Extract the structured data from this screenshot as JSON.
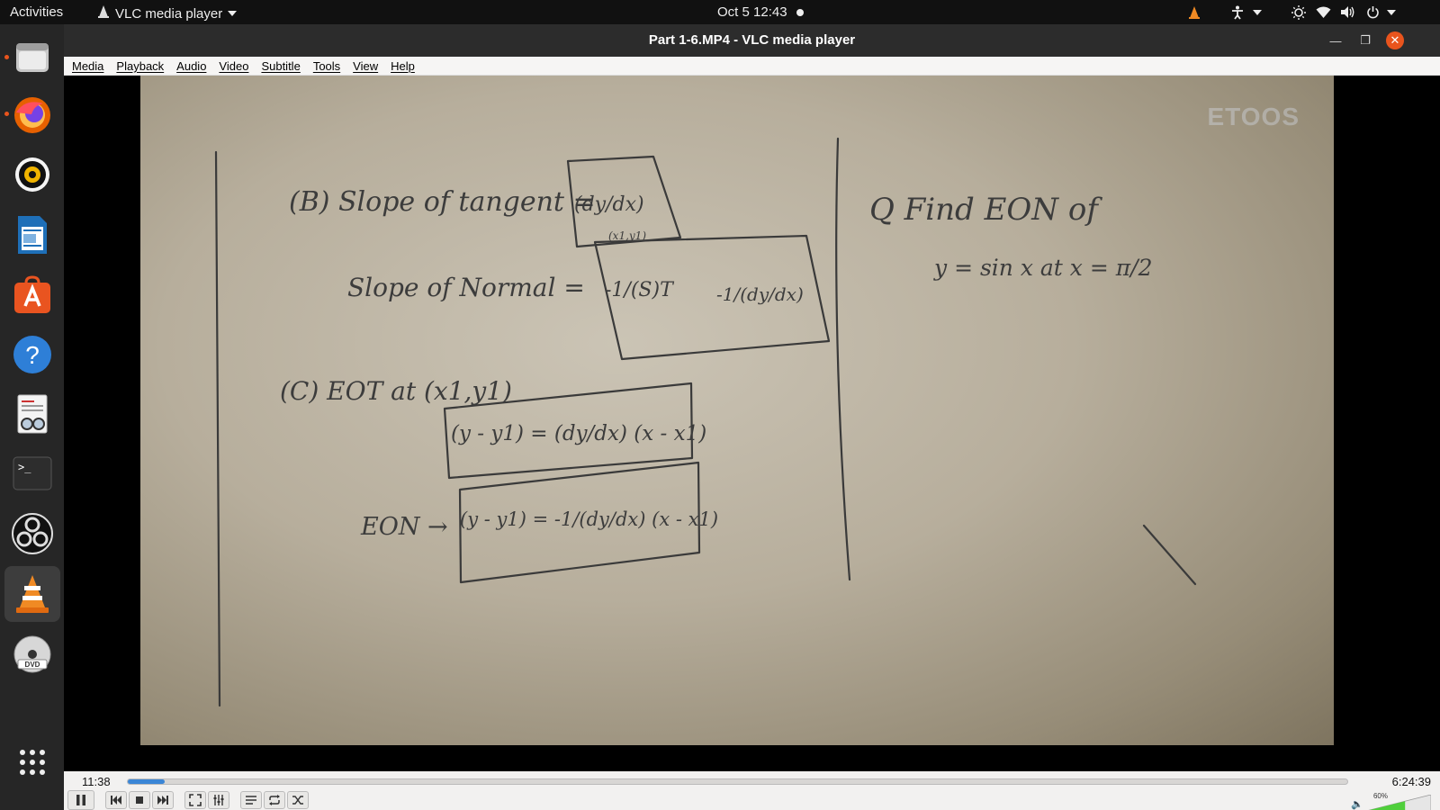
{
  "topbar": {
    "activities": "Activities",
    "app_name": "VLC media player",
    "clock": "Oct 5  12:43"
  },
  "window": {
    "title": "Part 1-6.MP4 - VLC media player"
  },
  "menu": [
    "Media",
    "Playback",
    "Audio",
    "Video",
    "Subtitle",
    "Tools",
    "View",
    "Help"
  ],
  "dock": [
    {
      "name": "files-icon",
      "running": true
    },
    {
      "name": "firefox-icon",
      "running": true
    },
    {
      "name": "rhythmbox-icon",
      "running": false
    },
    {
      "name": "writer-icon",
      "running": false
    },
    {
      "name": "software-icon",
      "running": false
    },
    {
      "name": "help-icon",
      "running": false
    },
    {
      "name": "document-viewer-icon",
      "running": false
    },
    {
      "name": "terminal-icon",
      "running": false
    },
    {
      "name": "obs-icon",
      "running": false
    },
    {
      "name": "vlc-icon",
      "running": true,
      "active": true
    },
    {
      "name": "dvd-icon",
      "running": false
    },
    {
      "name": "show-apps-icon",
      "running": false
    }
  ],
  "video": {
    "watermark": "ETOOS",
    "board_left": {
      "b_label": "(B) Slope of tangent =",
      "dydx": "(dy/dx)",
      "point_sub": "(x1,y1)",
      "normal_label": "Slope of Normal =",
      "normal_frac1": "-1/(S)T",
      "normal_frac2": "-1/(dy/dx)",
      "c_label": "(C) EOT at (x1,y1)",
      "eot_eq": "(y - y1) = (dy/dx) (x - x1)",
      "eon_label": "EON →",
      "eon_eq": "(y - y1) = -1/(dy/dx) (x - x1)"
    },
    "board_right": {
      "question": "Q Find EON of",
      "equation": "y = sin x  at x = π/2"
    }
  },
  "playback": {
    "elapsed": "11:38",
    "total": "6:24:39",
    "progress": 0.0303,
    "volume_label": "60%",
    "volume": 0.6
  },
  "colors": {
    "topbar": "#111111",
    "dock": "#262626",
    "accent": "#e9541d",
    "seek": "#3b86d6"
  }
}
